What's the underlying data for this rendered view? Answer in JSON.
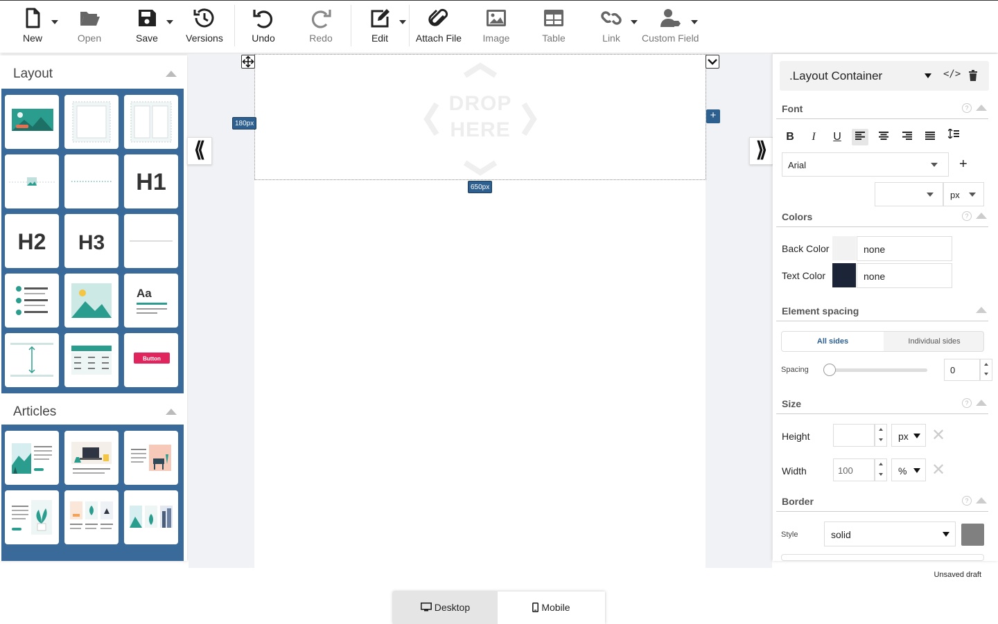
{
  "toolbar": {
    "items": [
      {
        "label": "New",
        "icon": "new-file-icon"
      },
      {
        "label": "Open",
        "icon": "folder-open-icon"
      },
      {
        "label": "Save",
        "icon": "save-icon"
      },
      {
        "label": "Versions",
        "icon": "history-icon"
      },
      {
        "label": "Undo",
        "icon": "undo-icon"
      },
      {
        "label": "Redo",
        "icon": "redo-icon"
      },
      {
        "label": "Edit",
        "icon": "edit-icon"
      },
      {
        "label": "Attach File",
        "icon": "paperclip-icon"
      },
      {
        "label": "Image",
        "icon": "image-icon"
      },
      {
        "label": "Table",
        "icon": "table-icon"
      },
      {
        "label": "Link",
        "icon": "link-icon"
      },
      {
        "label": "Custom Field",
        "icon": "user-tag-icon"
      }
    ]
  },
  "left_panel": {
    "layout_title": "Layout",
    "articles_title": "Articles",
    "tiles": {
      "h1": "H1",
      "h2": "H2",
      "h3": "H3",
      "aa": "Aa",
      "button": "Button"
    }
  },
  "canvas": {
    "drop_line1": "DROP",
    "drop_line2": "HERE",
    "height_badge": "180px",
    "width_badge": "650px"
  },
  "right_panel": {
    "element_name": ".Layout Container",
    "font": {
      "title": "Font",
      "family": "Arial",
      "size_unit": "px"
    },
    "colors": {
      "title": "Colors",
      "back_label": "Back Color",
      "back_value": "none",
      "back_swatch": "#f2f2f2",
      "text_label": "Text Color",
      "text_value": "none",
      "text_swatch": "#1c2438"
    },
    "spacing": {
      "title": "Element spacing",
      "tab_all": "All sides",
      "tab_individual": "Individual sides",
      "label": "Spacing",
      "value": "0"
    },
    "size": {
      "title": "Size",
      "height_label": "Height",
      "height_value": "",
      "height_unit": "px",
      "width_label": "Width",
      "width_value": "100",
      "width_unit": "%"
    },
    "border": {
      "title": "Border",
      "style_label": "Style",
      "style_value": "solid",
      "swatch": "#808080"
    }
  },
  "status_text": "Unsaved draft",
  "view_switch": {
    "desktop": "Desktop",
    "mobile": "Mobile",
    "active": "Desktop"
  },
  "colors": {
    "accent": "#2d5f8f",
    "tile_panel": "#3a6a9a",
    "teal": "#2a9d8f"
  }
}
